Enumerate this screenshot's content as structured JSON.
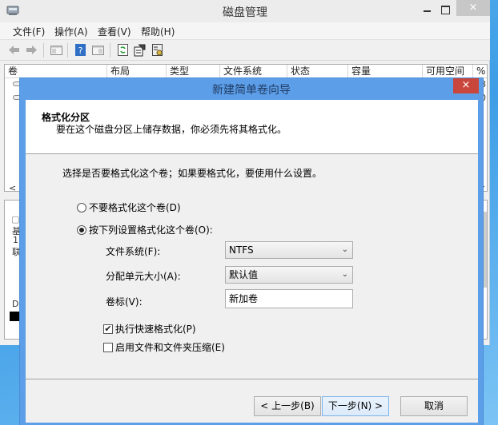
{
  "background_window": {
    "title": "磁盘管理",
    "close_glyph": "×",
    "menu": [
      "文件(F)",
      "操作(A)",
      "查看(V)",
      "帮助(H)"
    ],
    "toolbar_icons": [
      "back-arrow-icon",
      "forward-arrow-icon",
      "show-hide-console-tree-icon",
      "help-icon",
      "show-hide-action-pane-icon",
      "refresh-icon",
      "properties-icon",
      "settings-icon"
    ],
    "columns": [
      "卷",
      "布局",
      "类型",
      "文件系统",
      "状态",
      "容量",
      "可用空间",
      "%"
    ],
    "row_stubs": [
      "8",
      "0"
    ],
    "scroll_left": "<",
    "lower_stubs": [
      "基",
      "1",
      "联",
      "D"
    ]
  },
  "dialog": {
    "title": "新建简单卷向导",
    "close_glyph": "×",
    "header": {
      "title": "格式化分区",
      "subtitle": "要在这个磁盘分区上储存数据，你必须先将其格式化。"
    },
    "intro": "选择是否要格式化这个卷；如果要格式化，要使用什么设置。",
    "radios": [
      {
        "label": "不要格式化这个卷(D)",
        "checked": false
      },
      {
        "label": "按下列设置格式化这个卷(O):",
        "checked": true
      }
    ],
    "fields": {
      "file_system": {
        "label": "文件系统(F):",
        "value": "NTFS"
      },
      "allocation_unit": {
        "label": "分配单元大小(A):",
        "value": "默认值"
      },
      "volume_label": {
        "label": "卷标(V):",
        "value": "新加卷"
      }
    },
    "checkboxes": [
      {
        "label": "执行快速格式化(P)",
        "checked": true,
        "mark": "✔"
      },
      {
        "label": "启用文件和文件夹压缩(E)",
        "checked": false,
        "mark": ""
      }
    ],
    "buttons": {
      "back": "< 上一步(B)",
      "next": "下一步(N) >",
      "cancel": "取消"
    },
    "chevron_glyph": "⌄"
  }
}
